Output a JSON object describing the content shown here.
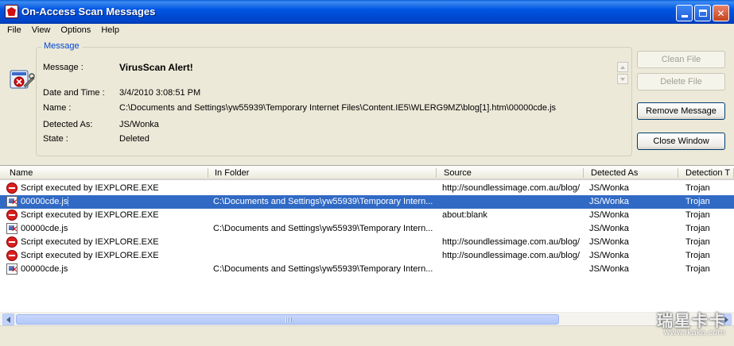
{
  "window": {
    "title": "On-Access Scan Messages",
    "app_icon": "mcafee-shield-icon",
    "controls": {
      "minimize": "minimize-icon",
      "maximize": "maximize-icon",
      "close": "✕"
    }
  },
  "menu": [
    "File",
    "View",
    "Options",
    "Help"
  ],
  "message_group": {
    "legend": "Message",
    "fields": [
      {
        "label": "Message :",
        "value": "VirusScan Alert!"
      },
      {
        "label": "Date and Time :",
        "value": "3/4/2010 3:08:51 PM"
      },
      {
        "label": "Name :",
        "value": "C:\\Documents and Settings\\yw55939\\Temporary Internet Files\\Content.IE5\\WLERG9MZ\\blog[1].htm\\00000cde.js"
      },
      {
        "label": "Detected As:",
        "value": "JS/Wonka"
      },
      {
        "label": "State :",
        "value": "Deleted"
      }
    ]
  },
  "buttons": {
    "clean": "Clean File",
    "delete": "Delete File",
    "remove": "Remove Message",
    "close": "Close Window"
  },
  "list": {
    "columns": [
      "Name",
      "In Folder",
      "Source",
      "Detected As",
      "Detection T"
    ],
    "rows": [
      {
        "icon": "blocked-icon",
        "name": "Script executed by IEXPLORE.EXE",
        "folder": "",
        "source": "http://soundlessimage.com.au/blog/",
        "detected": "JS/Wonka",
        "type": "Trojan",
        "selected": false
      },
      {
        "icon": "infected-file-icon",
        "name": "00000cde.js",
        "folder": "C:\\Documents and Settings\\yw55939\\Temporary Intern...",
        "source": "",
        "detected": "JS/Wonka",
        "type": "Trojan",
        "selected": true
      },
      {
        "icon": "blocked-icon",
        "name": "Script executed by IEXPLORE.EXE",
        "folder": "",
        "source": "about:blank",
        "detected": "JS/Wonka",
        "type": "Trojan",
        "selected": false
      },
      {
        "icon": "infected-file-icon",
        "name": "00000cde.js",
        "folder": "C:\\Documents and Settings\\yw55939\\Temporary Intern...",
        "source": "",
        "detected": "JS/Wonka",
        "type": "Trojan",
        "selected": false
      },
      {
        "icon": "blocked-icon",
        "name": "Script executed by IEXPLORE.EXE",
        "folder": "",
        "source": "http://soundlessimage.com.au/blog/",
        "detected": "JS/Wonka",
        "type": "Trojan",
        "selected": false
      },
      {
        "icon": "blocked-icon",
        "name": "Script executed by IEXPLORE.EXE",
        "folder": "",
        "source": "http://soundlessimage.com.au/blog/",
        "detected": "JS/Wonka",
        "type": "Trojan",
        "selected": false
      },
      {
        "icon": "infected-file-icon",
        "name": "00000cde.js",
        "folder": "C:\\Documents and Settings\\yw55939\\Temporary Intern...",
        "source": "",
        "detected": "JS/Wonka",
        "type": "Trojan",
        "selected": false
      }
    ]
  },
  "watermark": {
    "main": "瑞星卡卡",
    "sub": "www.ikaka.com"
  }
}
